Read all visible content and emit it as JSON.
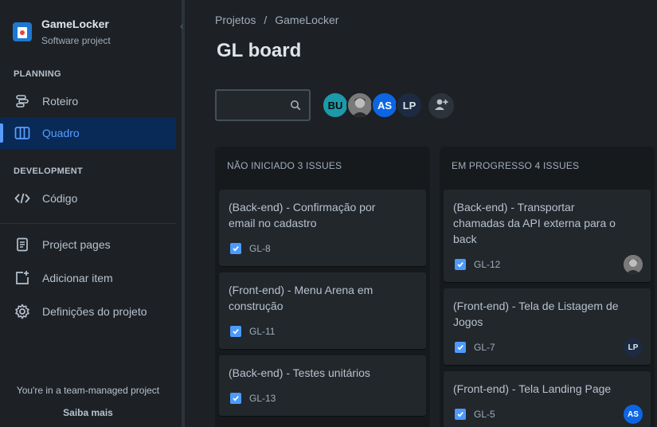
{
  "sidebar": {
    "project_name": "GameLocker",
    "project_type": "Software project",
    "planning_title": "PLANNING",
    "development_title": "DEVELOPMENT",
    "items": [
      {
        "label": "Roteiro"
      },
      {
        "label": "Quadro"
      },
      {
        "label": "Código"
      },
      {
        "label": "Project pages"
      },
      {
        "label": "Adicionar item"
      },
      {
        "label": "Definições do projeto"
      }
    ],
    "footer_text": "You're in a team-managed project",
    "footer_link": "Saiba mais"
  },
  "breadcrumb": [
    "Projetos",
    "/",
    "GameLocker"
  ],
  "page_title": "GL board",
  "search": {
    "value": "",
    "placeholder": ""
  },
  "members": [
    {
      "initials": "BU",
      "color": "#1d9aaa"
    },
    {
      "initials": "",
      "color": "#5a5a5a"
    },
    {
      "initials": "AS",
      "color": "#0c66e4"
    },
    {
      "initials": "LP",
      "color": "#1c2b41"
    }
  ],
  "columns": [
    {
      "title": "NÃO INICIADO 3 ISSUES",
      "cards": [
        {
          "title": "(Back-end) - Confirmação por email no cadastro",
          "key": "GL-8"
        },
        {
          "title": "(Front-end) - Menu Arena em construção",
          "key": "GL-11"
        },
        {
          "title": "(Back-end) - Testes unitários",
          "key": "GL-13"
        }
      ]
    },
    {
      "title": "EM PROGRESSO 4 ISSUES",
      "cards": [
        {
          "title": "(Back-end) - Transportar chamadas da API externa para o back",
          "key": "GL-12",
          "assignee": ""
        },
        {
          "title": "(Front-end) - Tela de Listagem de Jogos",
          "key": "GL-7",
          "assignee": "LP"
        },
        {
          "title": "(Front-end) - Tela Landing Page",
          "key": "GL-5",
          "assignee": "AS"
        }
      ]
    }
  ],
  "colors": {
    "accent": "#579dff",
    "background": "#1d2125",
    "card": "#22272b",
    "column": "#161a1d"
  }
}
